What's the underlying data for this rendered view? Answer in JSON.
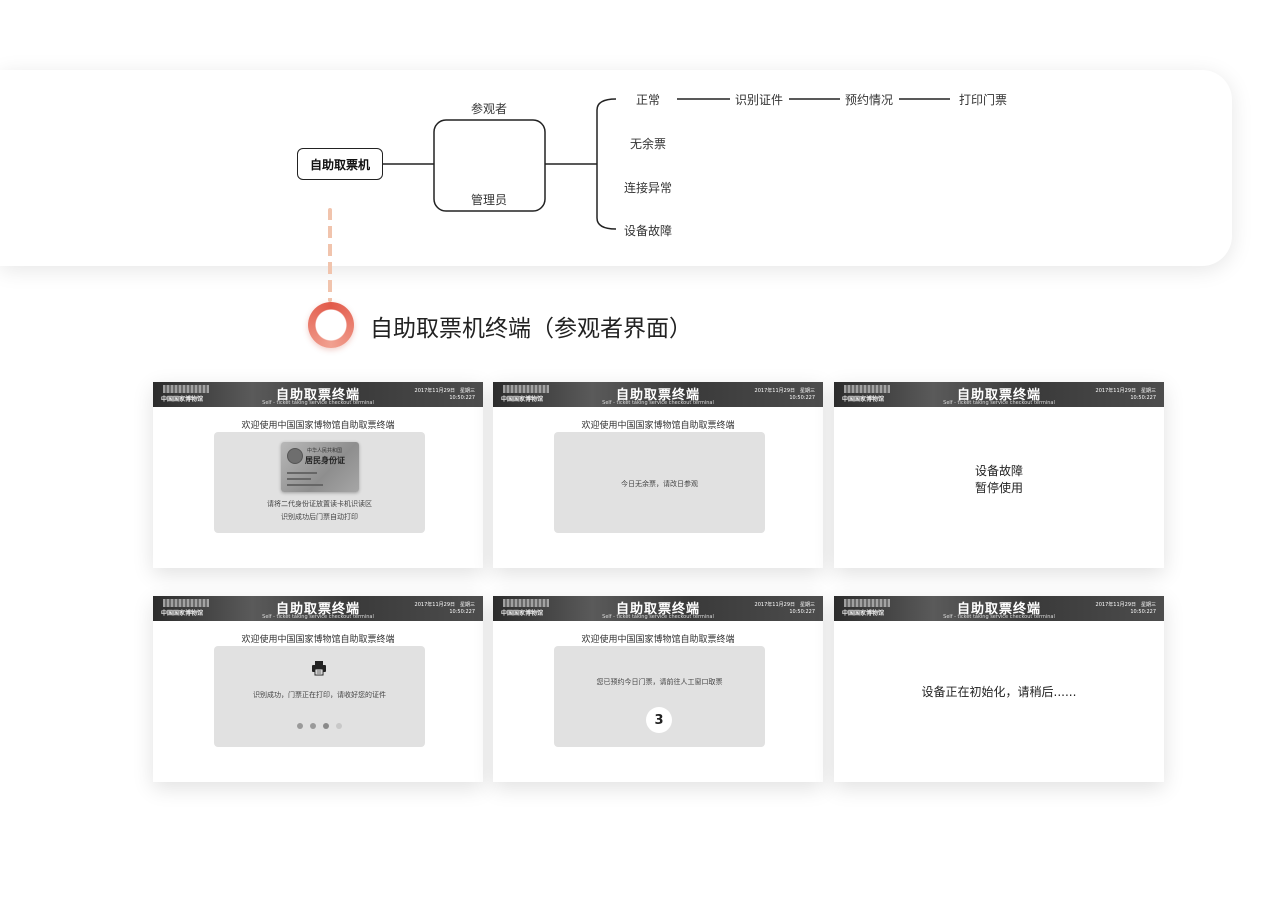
{
  "flow": {
    "root": "自助取票机",
    "roles": [
      "参观者",
      "管理员"
    ],
    "branches": [
      "正常",
      "无余票",
      "连接异常",
      "设备故障"
    ],
    "normal_steps": [
      "识别证件",
      "预约情况",
      "打印门票"
    ]
  },
  "section_title": "自助取票机终端（参观者界面）",
  "header": {
    "title": "自助取票终端",
    "subtitle": "Self - ticket taking service checkout terminal",
    "logo_text": "中国国家博物馆",
    "date": "2017年11月29日　星期三",
    "time": "10:50:227"
  },
  "welcome": "欢迎使用中国国家博物馆自助取票终端",
  "screens": {
    "scan": {
      "card_line1": "中华人民共和国",
      "card_line2": "居民身份证",
      "line1": "请将二代身份证放置读卡机识读区",
      "line2": "识别成功后门票自动打印"
    },
    "no_ticket": {
      "message": "今日无余票，请改日参观"
    },
    "fault": {
      "line1": "设备故障",
      "line2": "暂停使用"
    },
    "printing": {
      "message": "识别成功，门票正在打印，请收好您的证件"
    },
    "booked": {
      "message": "您已预约今日门票，请前往人工窗口取票",
      "countdown": "3"
    },
    "init": {
      "message": "设备正在初始化，请稍后......"
    }
  },
  "colors": {
    "accent": "#e25a4a",
    "dash": "#f1c4ad",
    "panel": "#e1e1e1"
  }
}
